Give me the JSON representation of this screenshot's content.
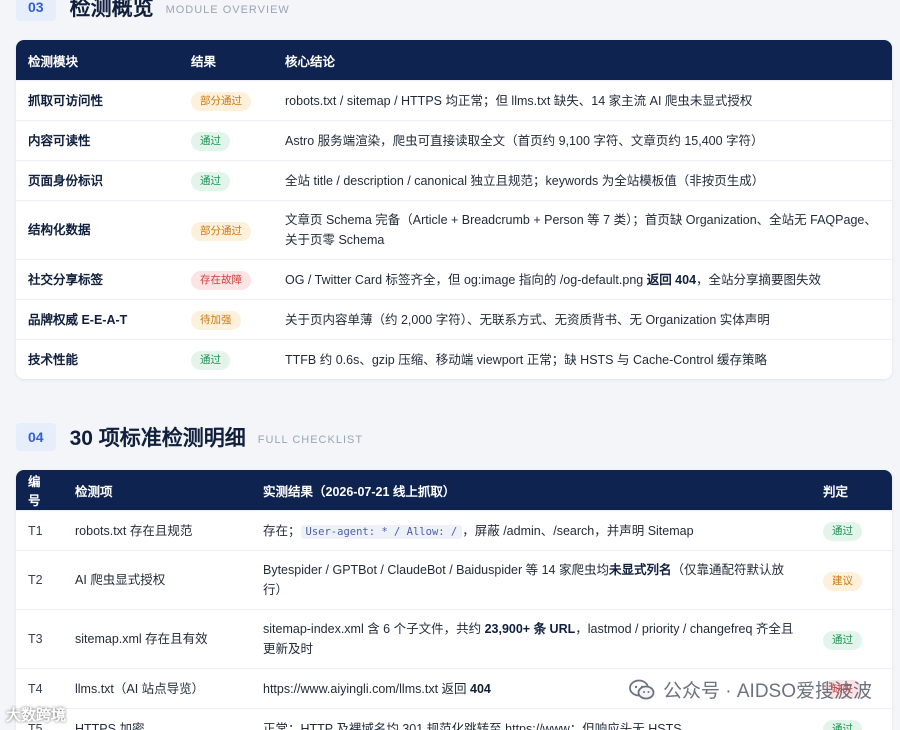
{
  "section3": {
    "num": "03",
    "title": "检测概览",
    "subtitle": "MODULE OVERVIEW",
    "headers": [
      "检测模块",
      "结果",
      "核心结论"
    ],
    "rows": [
      {
        "module": "抓取可访问性",
        "badge": "部分通过",
        "badge_type": "partial",
        "text": "robots.txt / sitemap / HTTPS 均正常；但 llms.txt 缺失、14 家主流 AI 爬虫未显式授权"
      },
      {
        "module": "内容可读性",
        "badge": "通过",
        "badge_type": "pass",
        "text": "Astro 服务端渲染，爬虫可直接读取全文（首页约 9,100 字符、文章页约 15,400 字符）"
      },
      {
        "module": "页面身份标识",
        "badge": "通过",
        "badge_type": "pass",
        "text": "全站 title / description / canonical 独立且规范；keywords 为全站模板值（非按页生成）"
      },
      {
        "module": "结构化数据",
        "badge": "部分通过",
        "badge_type": "partial",
        "text": "文章页 Schema 完备（Article + Breadcrumb + Person 等 7 类）；首页缺 Organization、全站无 FAQPage、关于页零 Schema"
      },
      {
        "module": "社交分享标签",
        "badge": "存在故障",
        "badge_type": "fail",
        "text_pre": "OG / Twitter Card 标签齐全，但 og:image 指向的 /og-default.png ",
        "text_bold": "返回 404",
        "text_post": "，全站分享摘要图失效"
      },
      {
        "module": "品牌权威 E-E-A-T",
        "badge": "待加强",
        "badge_type": "weak",
        "text": "关于页内容单薄（约 2,000 字符）、无联系方式、无资质背书、无 Organization 实体声明"
      },
      {
        "module": "技术性能",
        "badge": "通过",
        "badge_type": "pass",
        "text": "TTFB 约 0.6s、gzip 压缩、移动端 viewport 正常；缺 HSTS 与 Cache-Control 缓存策略"
      }
    ]
  },
  "section4": {
    "num": "04",
    "title": "30 项标准检测明细",
    "subtitle": "FULL CHECKLIST",
    "headers": [
      "编号",
      "检测项",
      "实测结果（2026-07-21 线上抓取）",
      "判定"
    ],
    "rows": [
      {
        "id": "T1",
        "item": "robots.txt 存在且规范",
        "pre": "存在；",
        "code": "User-agent: * / Allow: /",
        "post": "，屏蔽 /admin、/search，并声明 Sitemap",
        "badge": "通过",
        "badge_type": "pass"
      },
      {
        "id": "T2",
        "item": "AI 爬虫显式授权",
        "pre": "Bytespider / GPTBot / ClaudeBot / Baiduspider 等 14 家爬虫均",
        "bold": "未显式列名",
        "post": "（仅靠通配符默认放行）",
        "badge": "建议",
        "badge_type": "suggest"
      },
      {
        "id": "T3",
        "item": "sitemap.xml 存在且有效",
        "pre": "sitemap-index.xml 含 6 个子文件，共约 ",
        "bold": "23,900+ 条 URL",
        "post": "，lastmod / priority / changefreq 齐全且更新及时",
        "badge": "通过",
        "badge_type": "pass"
      },
      {
        "id": "T4",
        "item": "llms.txt（AI 站点导览）",
        "pre": "https://www.aiyingli.com/llms.txt 返回 ",
        "bold": "404",
        "post": "",
        "badge": "缺失",
        "badge_type": "missing"
      },
      {
        "id": "T5",
        "item": "HTTPS 加密",
        "pre": "正常：HTTP 及裸域名均 301 规范化跳转至 https://www；但响应头无 HSTS",
        "bold": "",
        "post": "",
        "badge": "通过",
        "badge_type": "pass"
      }
    ]
  },
  "watermark": {
    "text": "公众号 · AIDSO爱搜波波"
  },
  "corner_logo": "大数跨境"
}
